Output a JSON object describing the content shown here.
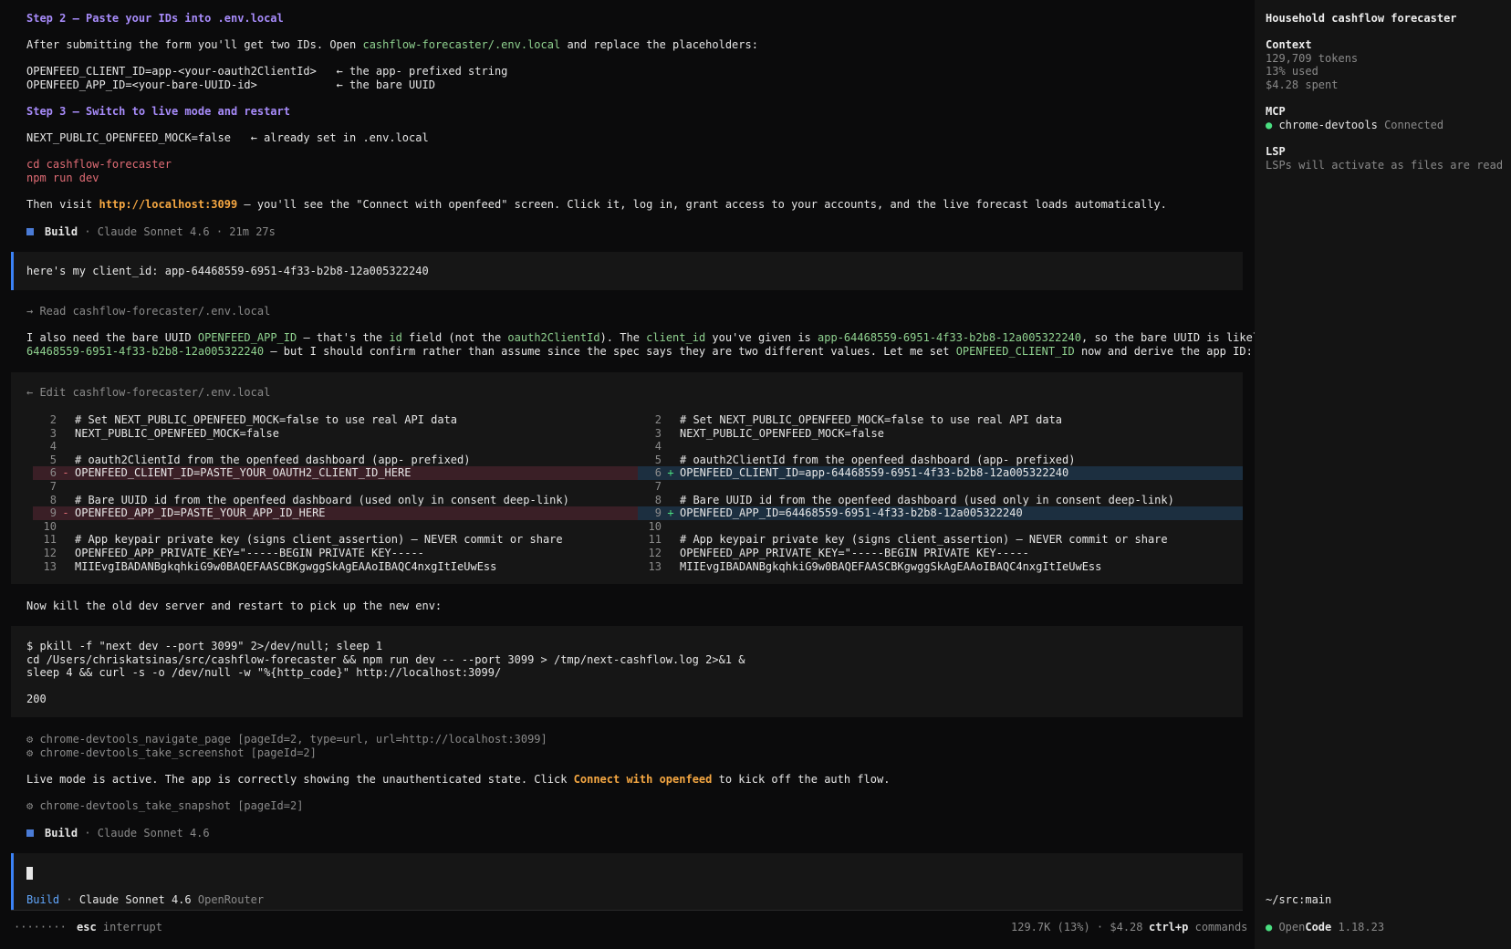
{
  "chat": {
    "step2_heading": "Step 2 — Paste your IDs into .env.local",
    "step2_text_a": "After submitting the form you'll get two IDs. Open ",
    "step2_file": "cashflow-forecaster/.env.local",
    "step2_text_b": " and replace the placeholders:",
    "env_line1": "OPENFEED_CLIENT_ID=app-<your-oauth2ClientId>   ← the app- prefixed string",
    "env_line2": "OPENFEED_APP_ID=<your-bare-UUID-id>            ← the bare UUID",
    "step3_heading": "Step 3 — Switch to live mode and restart",
    "mock_line": "NEXT_PUBLIC_OPENFEED_MOCK=false   ← already set in .env.local",
    "cmd1": "cd cashflow-forecaster",
    "cmd2": "npm run dev",
    "visit_a": "Then visit ",
    "visit_url": "http://localhost:3099",
    "visit_b": " — you'll see the \"Connect with openfeed\" screen. Click it, log in, grant access to your accounts, and the live forecast loads automatically.",
    "build1_label": "Build",
    "build1_meta": " · Claude Sonnet 4.6 · 21m 27s",
    "user_msg": "here's my client_id: app-64468559-6951-4f33-b2b8-12a005322240",
    "read_tool": "→ Read cashflow-forecaster/.env.local",
    "p1_a": "I also need the bare UUID ",
    "p1_b": "OPENFEED_APP_ID",
    "p1_c": " — that's the ",
    "p1_d": "id",
    "p1_e": " field (not the ",
    "p1_f": "oauth2ClientId",
    "p1_g": "). The ",
    "p1_h": "client_id",
    "p1_i": " you've given is ",
    "p1_j": "app-64468559-6951-4f33-b2b8-12a005322240",
    "p1_k": ", so the bare UUID is likely",
    "p2_a": "64468559-6951-4f33-b2b8-12a005322240",
    "p2_b": " — but I should confirm rather than assume since the spec says they are two different values. Let me set ",
    "p2_c": "OPENFEED_CLIENT_ID",
    "p2_d": " now and derive the app ID:",
    "edit_tool": "← Edit cashflow-forecaster/.env.local",
    "diff_left": [
      {
        "n": "2",
        "m": "",
        "t": "# Set NEXT_PUBLIC_OPENFEED_MOCK=false to use real API data",
        "k": ""
      },
      {
        "n": "3",
        "m": "",
        "t": "NEXT_PUBLIC_OPENFEED_MOCK=false",
        "k": ""
      },
      {
        "n": "4",
        "m": "",
        "t": "",
        "k": ""
      },
      {
        "n": "5",
        "m": "",
        "t": "# oauth2ClientId from the openfeed dashboard (app- prefixed)",
        "k": ""
      },
      {
        "n": "6",
        "m": "-",
        "t": "OPENFEED_CLIENT_ID=PASTE_YOUR_OAUTH2_CLIENT_ID_HERE",
        "k": "del"
      },
      {
        "n": "7",
        "m": "",
        "t": "",
        "k": ""
      },
      {
        "n": "8",
        "m": "",
        "t": "# Bare UUID id from the openfeed dashboard (used only in consent deep-link)",
        "k": ""
      },
      {
        "n": "9",
        "m": "-",
        "t": "OPENFEED_APP_ID=PASTE_YOUR_APP_ID_HERE",
        "k": "del"
      },
      {
        "n": "10",
        "m": "",
        "t": "",
        "k": ""
      },
      {
        "n": "11",
        "m": "",
        "t": "# App keypair private key (signs client_assertion) — NEVER commit or share",
        "k": ""
      },
      {
        "n": "12",
        "m": "",
        "t": "OPENFEED_APP_PRIVATE_KEY=\"-----BEGIN PRIVATE KEY-----",
        "k": ""
      },
      {
        "n": "13",
        "m": "",
        "t": "MIIEvgIBADANBgkqhkiG9w0BAQEFAASCBKgwggSkAgEAAoIBAQC4nxgItIeUwEss",
        "k": ""
      }
    ],
    "diff_right": [
      {
        "n": "2",
        "m": "",
        "t": "# Set NEXT_PUBLIC_OPENFEED_MOCK=false to use real API data",
        "k": ""
      },
      {
        "n": "3",
        "m": "",
        "t": "NEXT_PUBLIC_OPENFEED_MOCK=false",
        "k": ""
      },
      {
        "n": "4",
        "m": "",
        "t": "",
        "k": ""
      },
      {
        "n": "5",
        "m": "",
        "t": "# oauth2ClientId from the openfeed dashboard (app- prefixed)",
        "k": ""
      },
      {
        "n": "6",
        "m": "+",
        "t": "OPENFEED_CLIENT_ID=app-64468559-6951-4f33-b2b8-12a005322240",
        "k": "add"
      },
      {
        "n": "7",
        "m": "",
        "t": "",
        "k": ""
      },
      {
        "n": "8",
        "m": "",
        "t": "# Bare UUID id from the openfeed dashboard (used only in consent deep-link)",
        "k": ""
      },
      {
        "n": "9",
        "m": "+",
        "t": "OPENFEED_APP_ID=64468559-6951-4f33-b2b8-12a005322240",
        "k": "add"
      },
      {
        "n": "10",
        "m": "",
        "t": "",
        "k": ""
      },
      {
        "n": "11",
        "m": "",
        "t": "# App keypair private key (signs client_assertion) — NEVER commit or share",
        "k": ""
      },
      {
        "n": "12",
        "m": "",
        "t": "OPENFEED_APP_PRIVATE_KEY=\"-----BEGIN PRIVATE KEY-----",
        "k": ""
      },
      {
        "n": "13",
        "m": "",
        "t": "MIIEvgIBADANBgkqhkiG9w0BAQEFAASCBKgwggSkAgEAAoIBAQC4nxgItIeUwEss",
        "k": ""
      }
    ],
    "kill_text": "Now kill the old dev server and restart to pick up the new env:",
    "bash1": "$ pkill -f \"next dev --port 3099\" 2>/dev/null; sleep 1",
    "bash2": "cd /Users/chriskatsinas/src/cashflow-forecaster && npm run dev -- --port 3099 > /tmp/next-cashflow.log 2>&1 &",
    "bash3": "sleep 4 && curl -s -o /dev/null -w \"%{http_code}\" http://localhost:3099/",
    "bash_out": "200",
    "tool_nav": "⚙ chrome-devtools_navigate_page [pageId=2, type=url, url=http://localhost:3099]",
    "tool_shot": "⚙ chrome-devtools_take_screenshot [pageId=2]",
    "live_a": "Live mode is active. The app is correctly showing the unauthenticated state. Click ",
    "live_b": "Connect with openfeed",
    "live_c": " to kick off the auth flow.",
    "tool_snap": "⚙ chrome-devtools_take_snapshot [pageId=2]",
    "build2_label": "Build",
    "build2_meta": " · Claude Sonnet 4.6"
  },
  "input": {
    "mode": "Build",
    "model": "Claude Sonnet 4.6",
    "provider": "OpenRouter"
  },
  "statusbar": {
    "dots": "········",
    "esc_key": "esc",
    "esc_label": "interrupt",
    "usage": "129.7K (13%) · $4.28",
    "ctrl_key": "ctrl+p",
    "ctrl_label": "commands"
  },
  "sidebar": {
    "title": "Household cashflow forecaster",
    "context_heading": "Context",
    "tokens": "129,709 tokens",
    "used": "13% used",
    "spent": "$4.28 spent",
    "mcp_heading": "MCP",
    "mcp_server": "chrome-devtools",
    "mcp_status": "Connected",
    "lsp_heading": "LSP",
    "lsp_text": "LSPs will activate as files are read",
    "path": "~/src:main",
    "app_open": "Open",
    "app_code": "Code",
    "version": "1.18.23"
  },
  "colors": {
    "accent": "#a78bfa",
    "green": "#8fd18f",
    "orange": "#f5a742",
    "red": "#e06c75",
    "blue": "#3b82f6"
  }
}
